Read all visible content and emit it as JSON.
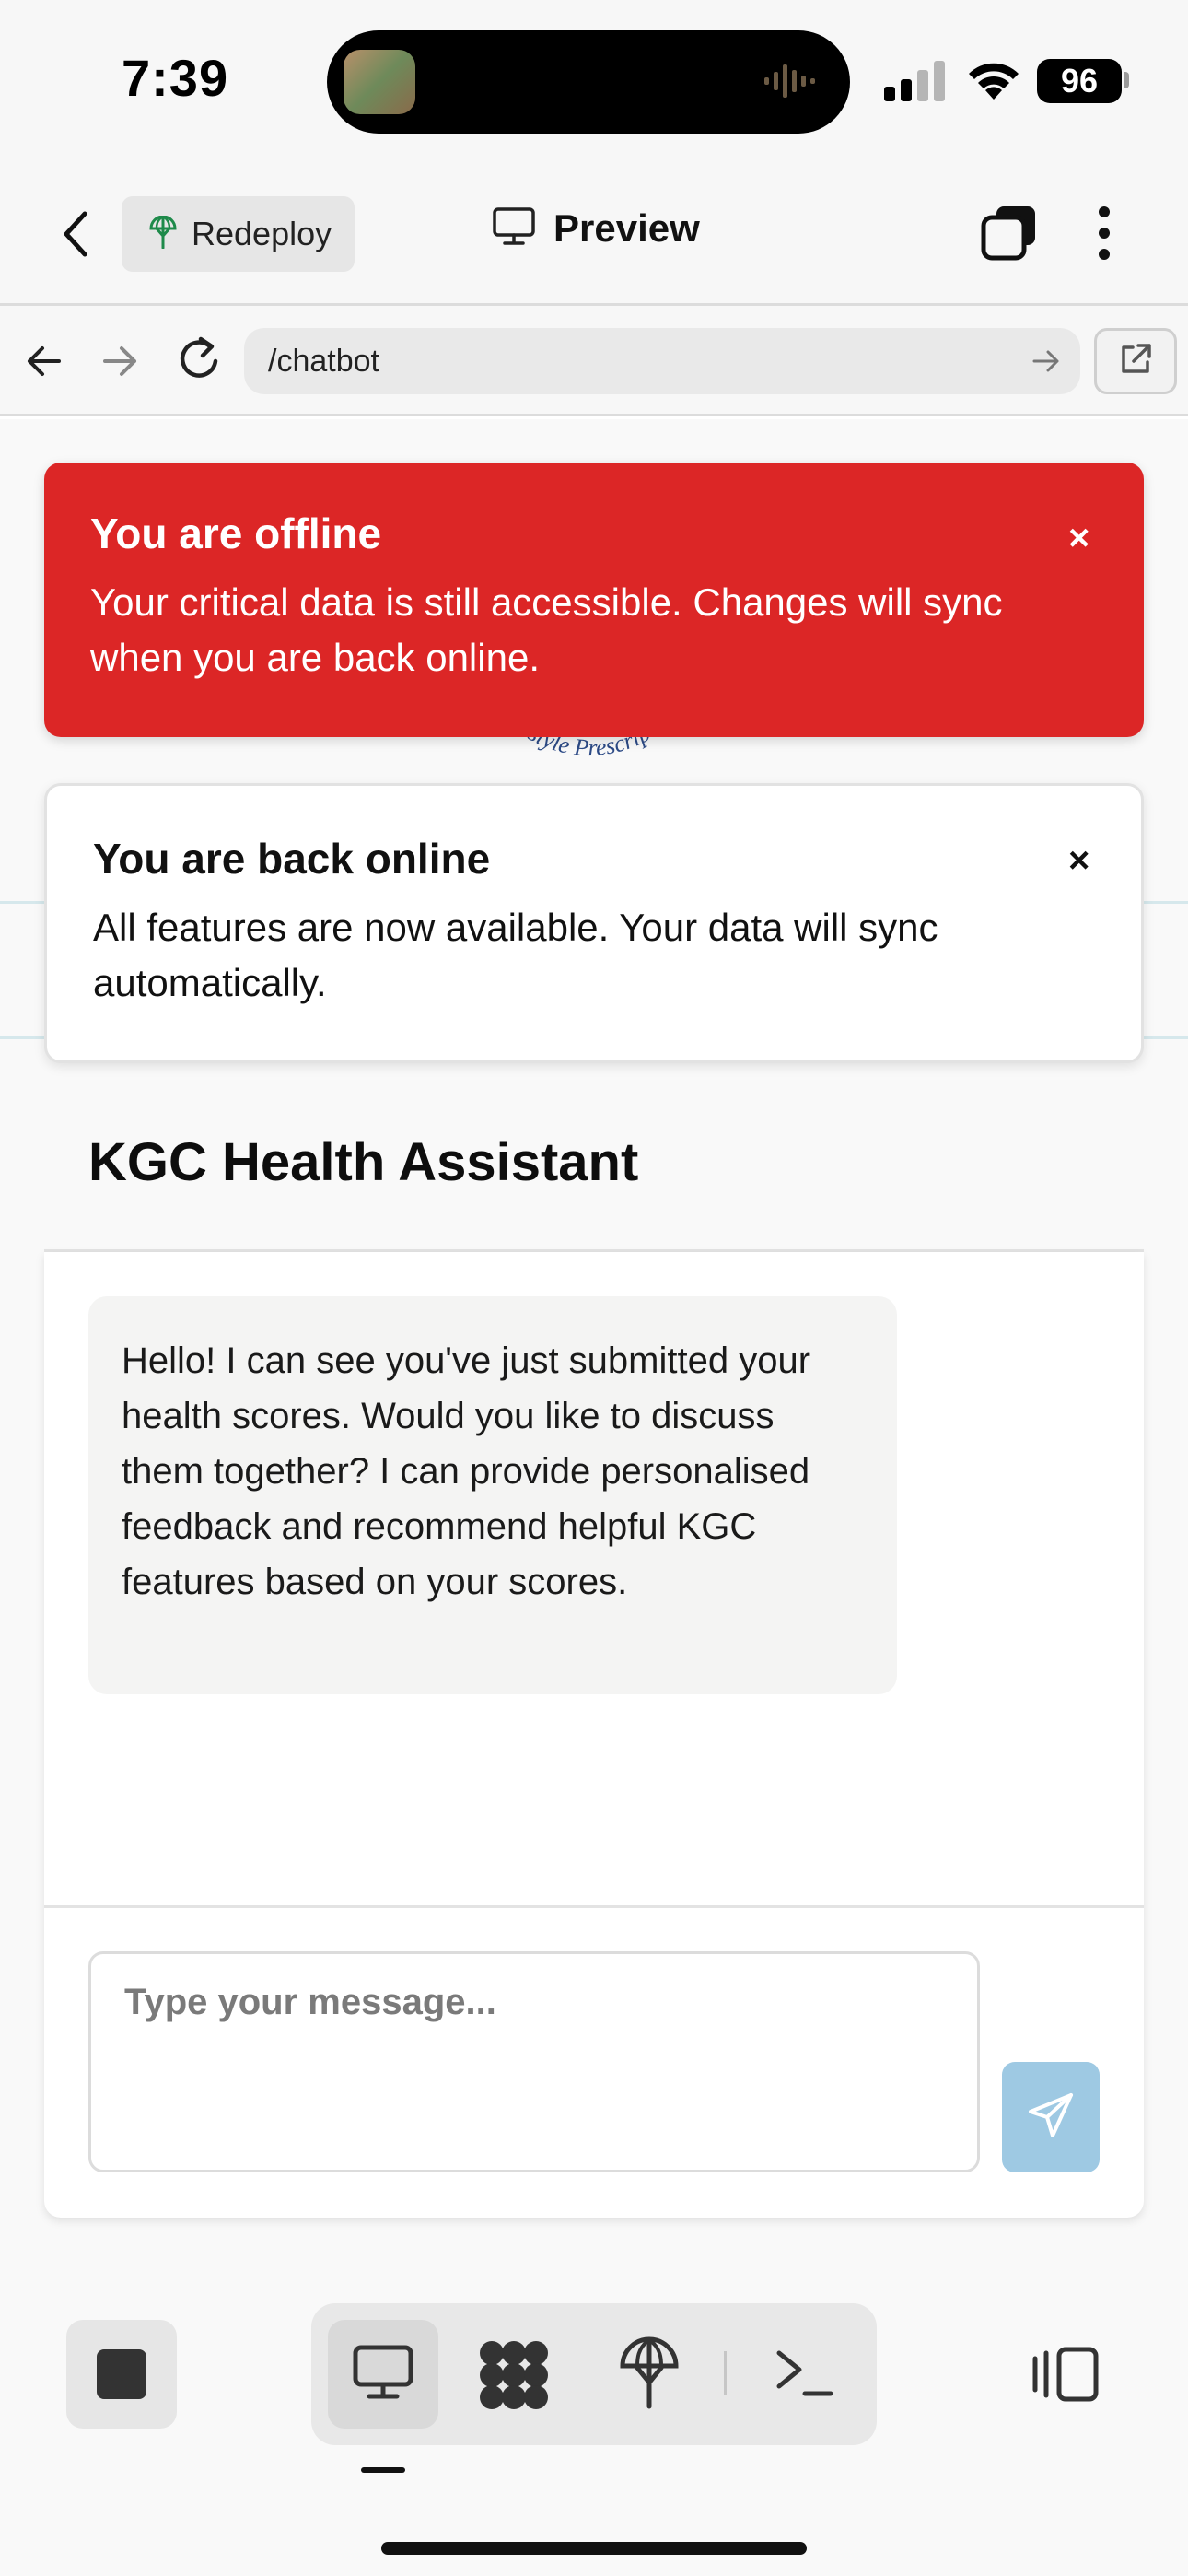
{
  "status_bar": {
    "time": "7:39",
    "battery": "96"
  },
  "header": {
    "redeploy_label": "Redeploy",
    "preview_label": "Preview"
  },
  "url_bar": {
    "url": "/chatbot"
  },
  "page": {
    "logo_text": "Lifestyle Prescription",
    "assistant_title": "KGC Health Assistant",
    "bot_message": "Hello! I can see you've just submitted your health scores. Would you like to discuss them together? I can provide personalised feedback and recommend helpful KGC features based on your scores.",
    "input_placeholder": "Type your message..."
  },
  "toasts": {
    "offline": {
      "title": "You are offline",
      "body": "Your critical data is still accessible. Changes will sync when you are back online.",
      "close": "×"
    },
    "online": {
      "title": "You are back online",
      "body": "All features are now available. Your data will sync automatically.",
      "close": "×"
    }
  },
  "colors": {
    "offline_toast": "#dc2626",
    "send_button": "#9ec9e3",
    "logo_blue": "#1f66a8"
  },
  "icons": {
    "header": [
      "chevron-left-icon",
      "globe-deploy-icon",
      "monitor-icon",
      "tabs-icon",
      "more-vertical-icon"
    ],
    "url_bar": [
      "arrow-left-icon",
      "arrow-right-icon",
      "reload-icon",
      "arrow-right-icon",
      "external-link-icon"
    ],
    "bottom_bar": [
      "stop-icon",
      "monitor-icon",
      "apps-icon",
      "deploy-icon",
      "terminal-icon",
      "panel-icon"
    ]
  }
}
